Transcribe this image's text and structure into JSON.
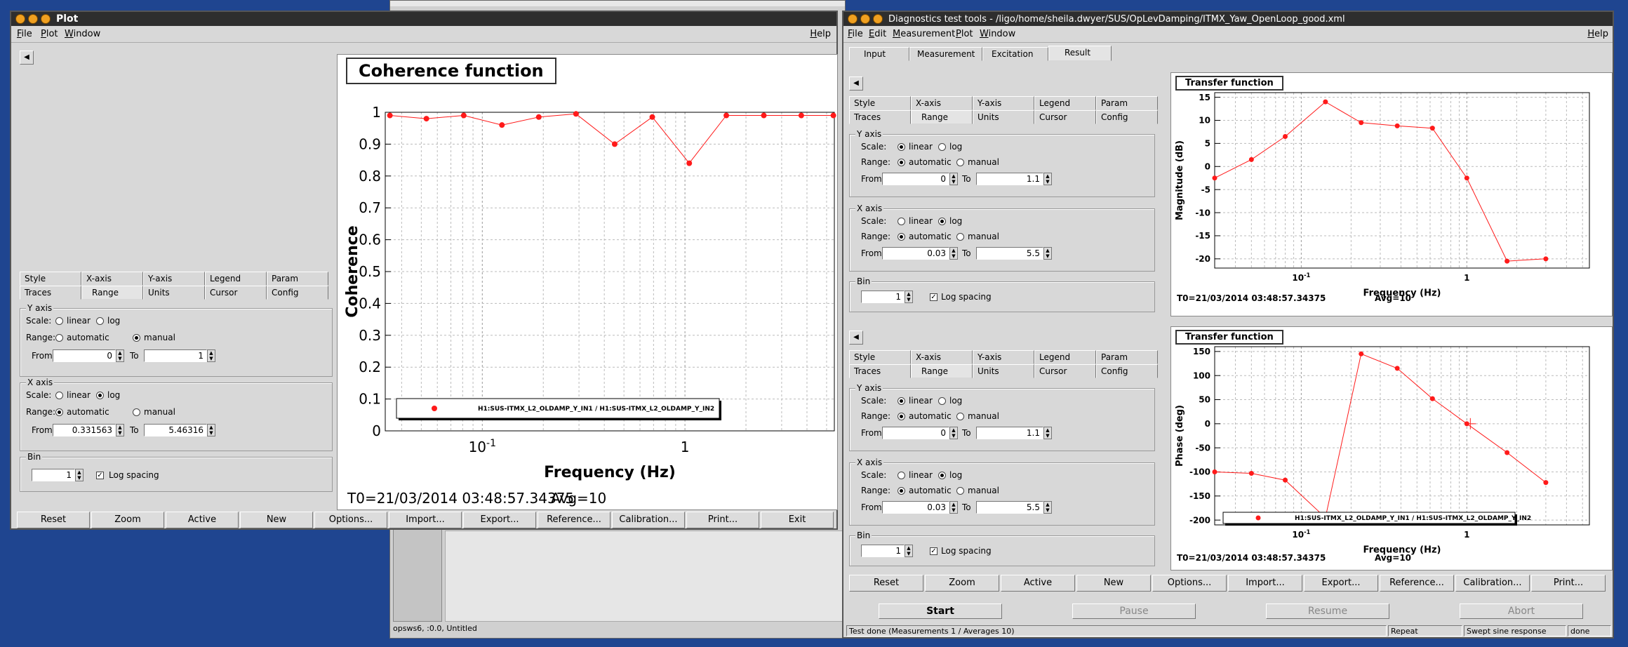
{
  "background_window": {
    "status_text": "opsws6, :0.0, Untitled"
  },
  "plot_window": {
    "title": "Plot",
    "menu": [
      "File",
      "Plot",
      "Window"
    ],
    "help": "Help",
    "tabs_row1": [
      "Style",
      "X-axis",
      "Y-axis",
      "Legend",
      "Param"
    ],
    "tabs_row2": [
      "Traces",
      "Range",
      "Units",
      "Cursor",
      "Config"
    ],
    "selected_tab": "Range",
    "yaxis": {
      "label": "Y axis",
      "scale_label": "Scale:",
      "linear": "linear",
      "log": "log",
      "scale_value": "linear",
      "range_label": "Range:",
      "automatic": "automatic",
      "manual": "manual",
      "range_value": "manual",
      "from_label": "From",
      "from": "0",
      "to_label": "To",
      "to": "1"
    },
    "xaxis": {
      "label": "X axis",
      "scale_label": "Scale:",
      "linear": "linear",
      "log": "log",
      "scale_value": "log",
      "range_label": "Range:",
      "automatic": "automatic",
      "manual": "manual",
      "range_value": "automatic",
      "from_label": "From",
      "from": "0.331563",
      "to_label": "To",
      "to": "5.46316"
    },
    "bin": {
      "label": "Bin",
      "value": "1",
      "log_spacing": "Log spacing",
      "log_checked": true
    },
    "buttons": [
      "Reset",
      "Zoom",
      "Active",
      "New",
      "Options...",
      "Import...",
      "Export...",
      "Reference...",
      "Calibration...",
      "Print...",
      "Exit"
    ],
    "chart_title": "Coherence function",
    "footer": "T0=21/03/2014 03:48:57.34375",
    "avg": "Avg=10"
  },
  "diag_window": {
    "title": "Diagnostics test tools - /ligo/home/sheila.dwyer/SUS/OpLevDamping/ITMX_Yaw_OpenLoop_good.xml",
    "menu": [
      "File",
      "Edit",
      "Measurement",
      "Plot",
      "Window"
    ],
    "help": "Help",
    "main_tabs": [
      "Input",
      "Measurement",
      "Excitation",
      "Result"
    ],
    "selected_main_tab": "Result",
    "panel_top": {
      "tabs_row1": [
        "Style",
        "X-axis",
        "Y-axis",
        "Legend",
        "Param"
      ],
      "tabs_row2": [
        "Traces",
        "Range",
        "Units",
        "Cursor",
        "Config"
      ],
      "yaxis": {
        "label": "Y axis",
        "scale_label": "Scale:",
        "linear": "linear",
        "log": "log",
        "scale_value": "linear",
        "range_label": "Range:",
        "automatic": "automatic",
        "manual": "manual",
        "range_value": "automatic",
        "from_label": "From",
        "from": "0",
        "to_label": "To",
        "to": "1.1"
      },
      "xaxis": {
        "label": "X axis",
        "scale_label": "Scale:",
        "linear": "linear",
        "log": "log",
        "scale_value": "log",
        "range_label": "Range:",
        "automatic": "automatic",
        "manual": "manual",
        "range_value": "automatic",
        "from_label": "From",
        "from": "0.03",
        "to_label": "To",
        "to": "5.5"
      },
      "bin": {
        "label": "Bin",
        "value": "1",
        "log_spacing": "Log spacing",
        "log_checked": true
      }
    },
    "panel_bottom": {
      "tabs_row1": [
        "Style",
        "X-axis",
        "Y-axis",
        "Legend",
        "Param"
      ],
      "tabs_row2": [
        "Traces",
        "Range",
        "Units",
        "Cursor",
        "Config"
      ],
      "yaxis": {
        "label": "Y axis",
        "scale_label": "Scale:",
        "linear": "linear",
        "log": "log",
        "scale_value": "linear",
        "range_label": "Range:",
        "automatic": "automatic",
        "manual": "manual",
        "range_value": "automatic",
        "from_label": "From",
        "from": "0",
        "to_label": "To",
        "to": "1.1"
      },
      "xaxis": {
        "label": "X axis",
        "scale_label": "Scale:",
        "linear": "linear",
        "log": "log",
        "scale_value": "log",
        "range_label": "Range:",
        "automatic": "automatic",
        "manual": "manual",
        "range_value": "automatic",
        "from_label": "From",
        "from": "0.03",
        "to_label": "To",
        "to": "5.5"
      },
      "bin": {
        "label": "Bin",
        "value": "1",
        "log_spacing": "Log spacing",
        "log_checked": true
      }
    },
    "plot_top": {
      "title": "Transfer function",
      "footer": "T0=21/03/2014 03:48:57.34375",
      "avg": "Avg=10"
    },
    "plot_bottom": {
      "title": "Transfer function",
      "footer": "T0=21/03/2014 03:48:57.34375",
      "avg": "Avg=10"
    },
    "buttons": [
      "Reset",
      "Zoom",
      "Active",
      "New",
      "Options...",
      "Import...",
      "Export...",
      "Reference...",
      "Calibration...",
      "Print..."
    ],
    "start": "Start",
    "pause": "Pause",
    "resume": "Resume",
    "abort": "Abort",
    "status": "Test done (Measurements 1 / Averages 10)",
    "repeat": "Repeat",
    "mode": "Swept sine response",
    "state": "done"
  },
  "chart_data": [
    {
      "type": "scatter",
      "title": "Coherence function",
      "xlabel": "Frequency (Hz)",
      "ylabel": "Coherence",
      "xscale": "log",
      "xlim": [
        0.0332,
        5.46
      ],
      "ylim": [
        0,
        1
      ],
      "yticks": [
        "0",
        "0.1",
        "0.2",
        "0.3",
        "0.4",
        "0.5",
        "0.6",
        "0.7",
        "0.8",
        "0.9",
        "1"
      ],
      "xticks": [
        "10^-1",
        "1"
      ],
      "legend": "H1:SUS-ITMX_L2_OLDAMP_Y_IN1 / H1:SUS-ITMX_L2_OLDAMP_Y_IN2",
      "series": [
        {
          "name": "H1:SUS-ITMX_L2_OLDAMP_Y_IN1 / H1:SUS-ITMX_L2_OLDAMP_Y_IN2",
          "x": [
            0.035,
            0.053,
            0.081,
            0.125,
            0.19,
            0.29,
            0.45,
            0.69,
            1.05,
            1.6,
            2.45,
            3.75,
            5.4
          ],
          "y": [
            0.99,
            0.98,
            0.99,
            0.96,
            0.985,
            0.995,
            0.9,
            0.985,
            0.84,
            0.99,
            0.99,
            0.99,
            0.99
          ]
        }
      ]
    },
    {
      "type": "line",
      "title": "Transfer function",
      "xlabel": "Frequency (Hz)",
      "ylabel": "Magnitude (dB)",
      "xscale": "log",
      "xlim": [
        0.03,
        5.5
      ],
      "ylim": [
        -22,
        16
      ],
      "yticks": [
        "15",
        "10",
        "5",
        "0",
        "-5",
        "-10",
        "-15",
        "-20"
      ],
      "xticks": [
        "10^-1",
        "1"
      ],
      "series": [
        {
          "x": [
            0.03,
            0.05,
            0.08,
            0.14,
            0.23,
            0.38,
            0.62,
            1.0,
            1.75,
            3.0
          ],
          "y": [
            -2.5,
            1.5,
            6.5,
            14,
            9.5,
            8.8,
            8.3,
            -2.5,
            -20.5,
            -20
          ]
        }
      ]
    },
    {
      "type": "line",
      "title": "Transfer function",
      "xlabel": "Frequency (Hz)",
      "ylabel": "Phase (deg)",
      "xscale": "log",
      "xlim": [
        0.03,
        5.5
      ],
      "ylim": [
        -210,
        160
      ],
      "yticks": [
        "150",
        "100",
        "50",
        "0",
        "-50",
        "-100",
        "-150",
        "-200"
      ],
      "xticks": [
        "10^-1",
        "1"
      ],
      "legend": "H1:SUS-ITMX_L2_OLDAMP_Y_IN1 / H1:SUS-ITMX_L2_OLDAMP_Y_IN2",
      "series": [
        {
          "name": "H1:SUS-ITMX_L2_OLDAMP_Y_IN1 / H1:SUS-ITMX_L2_OLDAMP_Y_IN2",
          "x": [
            0.03,
            0.05,
            0.08,
            0.14,
            0.23,
            0.38,
            0.62,
            1.0,
            1.75,
            3.0
          ],
          "y": [
            -100,
            -103,
            -117,
            -195,
            145,
            115,
            52,
            0,
            -60,
            -122
          ]
        }
      ]
    }
  ]
}
